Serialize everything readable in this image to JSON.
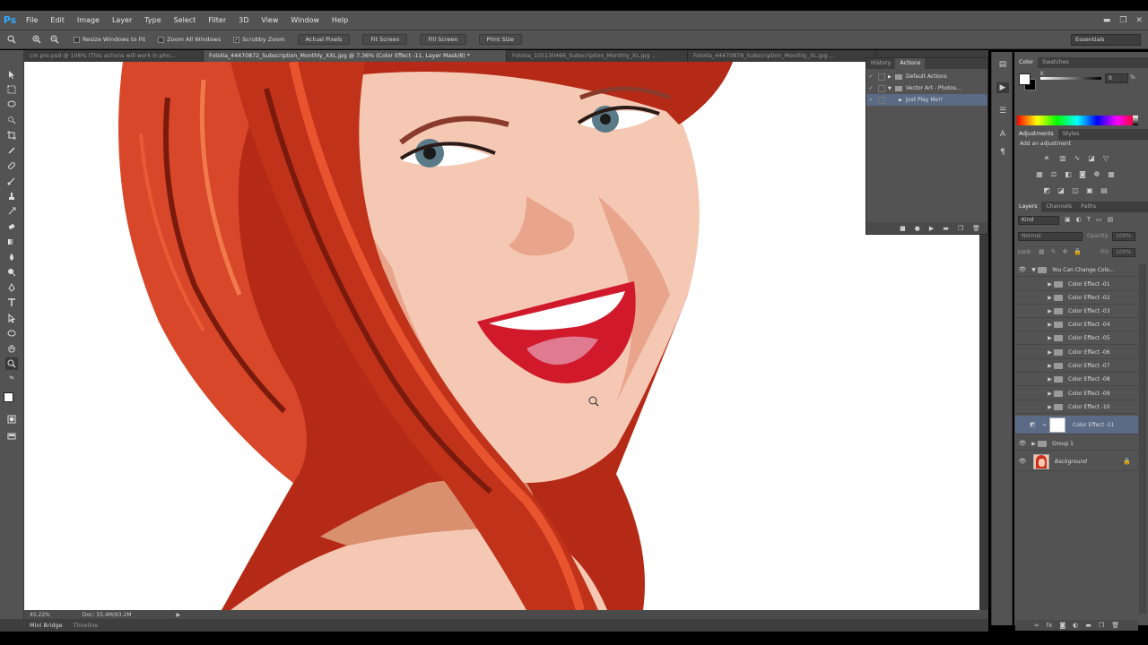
{
  "app": {
    "logo": "Ps"
  },
  "menu": [
    "File",
    "Edit",
    "Image",
    "Layer",
    "Type",
    "Select",
    "Filter",
    "3D",
    "View",
    "Window",
    "Help"
  ],
  "window_controls": {
    "minimize": "▬",
    "restore": "❐",
    "close": "✕"
  },
  "options": {
    "resize_windows": "Resize Windows to Fit",
    "zoom_all": "Zoom All Windows",
    "scrubby_zoom": "Scrubby Zoom",
    "actual_pixels": "Actual Pixels",
    "fit_screen": "Fit Screen",
    "fill_screen": "Fill Screen",
    "print_size": "Print Size",
    "workspace": "Essentials"
  },
  "tabs": [
    {
      "label": "cm pre.psd @ 106% (This actions will work in pho...",
      "active": false
    },
    {
      "label": "Fotolia_44470872_Subscription_Monthly_XXL.jpg @ 7.36% (Color Effect -11, Layer Mask/8) *",
      "active": true
    },
    {
      "label": "Fotolia_105130466_Subscription_Monthly_XL.jpg ...",
      "active": false
    },
    {
      "label": "Fotolia_44470878_Subscription_Monthly_XL.jpg ...",
      "active": false
    }
  ],
  "status": {
    "zoom": "45.22%",
    "doc": "Doc: 55.4M/93.2M"
  },
  "bottom_tabs": [
    "Mini Bridge",
    "Timeline"
  ],
  "actions_panel": {
    "tabs": [
      "History",
      "Actions"
    ],
    "rows": [
      "Default Actions",
      "Vector Art - Photos...",
      "Just Play Me!!"
    ]
  },
  "color_panel": {
    "tabs": [
      "Color",
      "Swatches"
    ],
    "k_label": "K",
    "k_value": "0",
    "k_unit": "%"
  },
  "adjustments_panel": {
    "tabs": [
      "Adjustments",
      "Styles"
    ],
    "title": "Add an adjustment"
  },
  "layers_panel": {
    "tabs": [
      "Layers",
      "Channels",
      "Paths"
    ],
    "kind": "Kind",
    "blend_mode": "Normal",
    "opacity_label": "Opacity:",
    "opacity_value": "100%",
    "lock_label": "Lock:",
    "fill_label": "Fill:",
    "fill_value": "100%",
    "group_top": "You Can Change Colo...",
    "effects": [
      "Color Effect -01",
      "Color Effect -02",
      "Color Effect -03",
      "Color Effect -04",
      "Color Effect -05",
      "Color Effect -06",
      "Color Effect -07",
      "Color Effect -08",
      "Color Effect -09",
      "Color Effect -10"
    ],
    "selected_layer": "Color Effect -11",
    "group1": "Group 1",
    "background": "Background"
  },
  "colors": {
    "ui_gray": "#535353",
    "selection": "#5b6a85",
    "hair": "#c9301a",
    "skin": "#f4c7b3",
    "lips": "#d01a2c"
  }
}
